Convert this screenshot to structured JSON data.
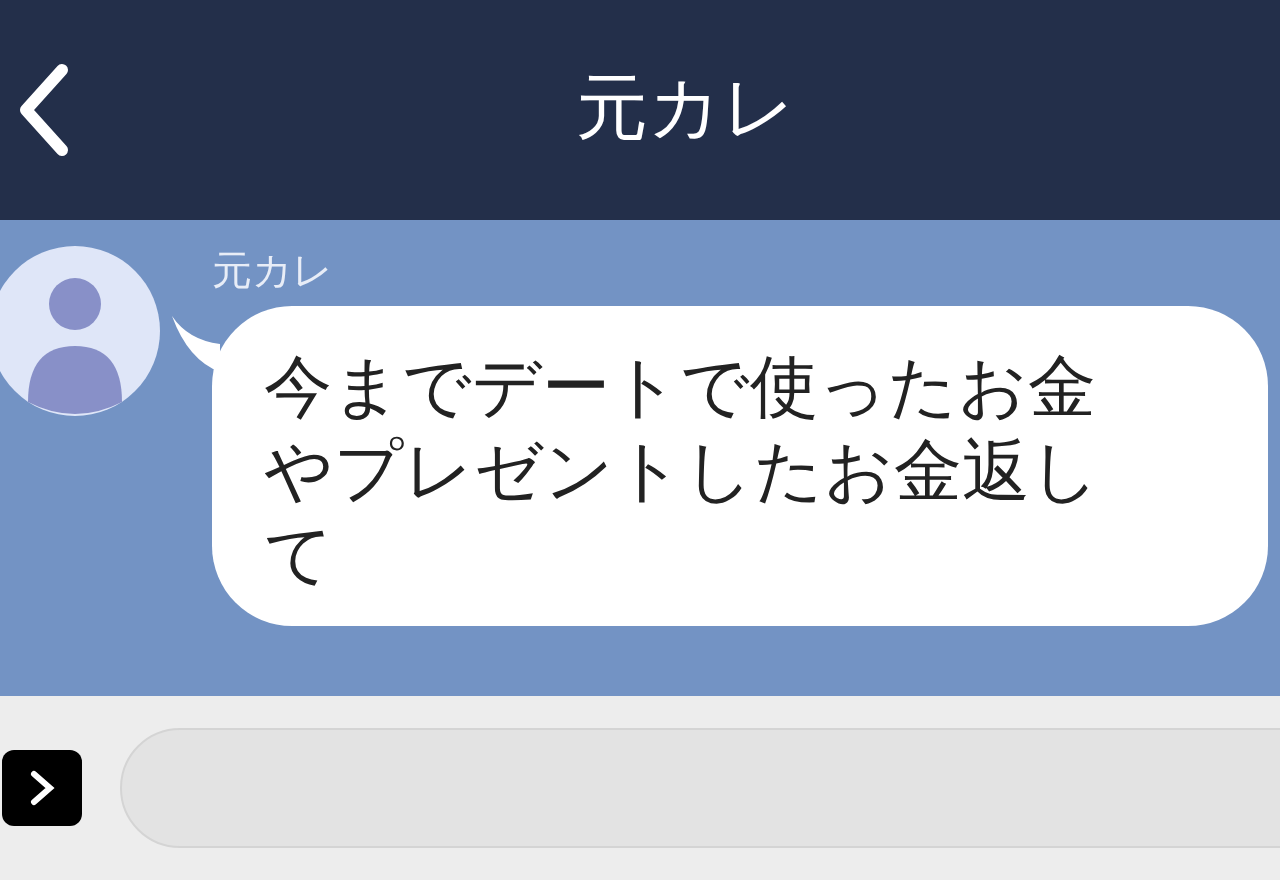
{
  "header": {
    "title": "元カレ"
  },
  "messages": [
    {
      "sender": "元カレ",
      "text": "今までデートで使ったお金やプレゼントしたお金返して"
    }
  ]
}
